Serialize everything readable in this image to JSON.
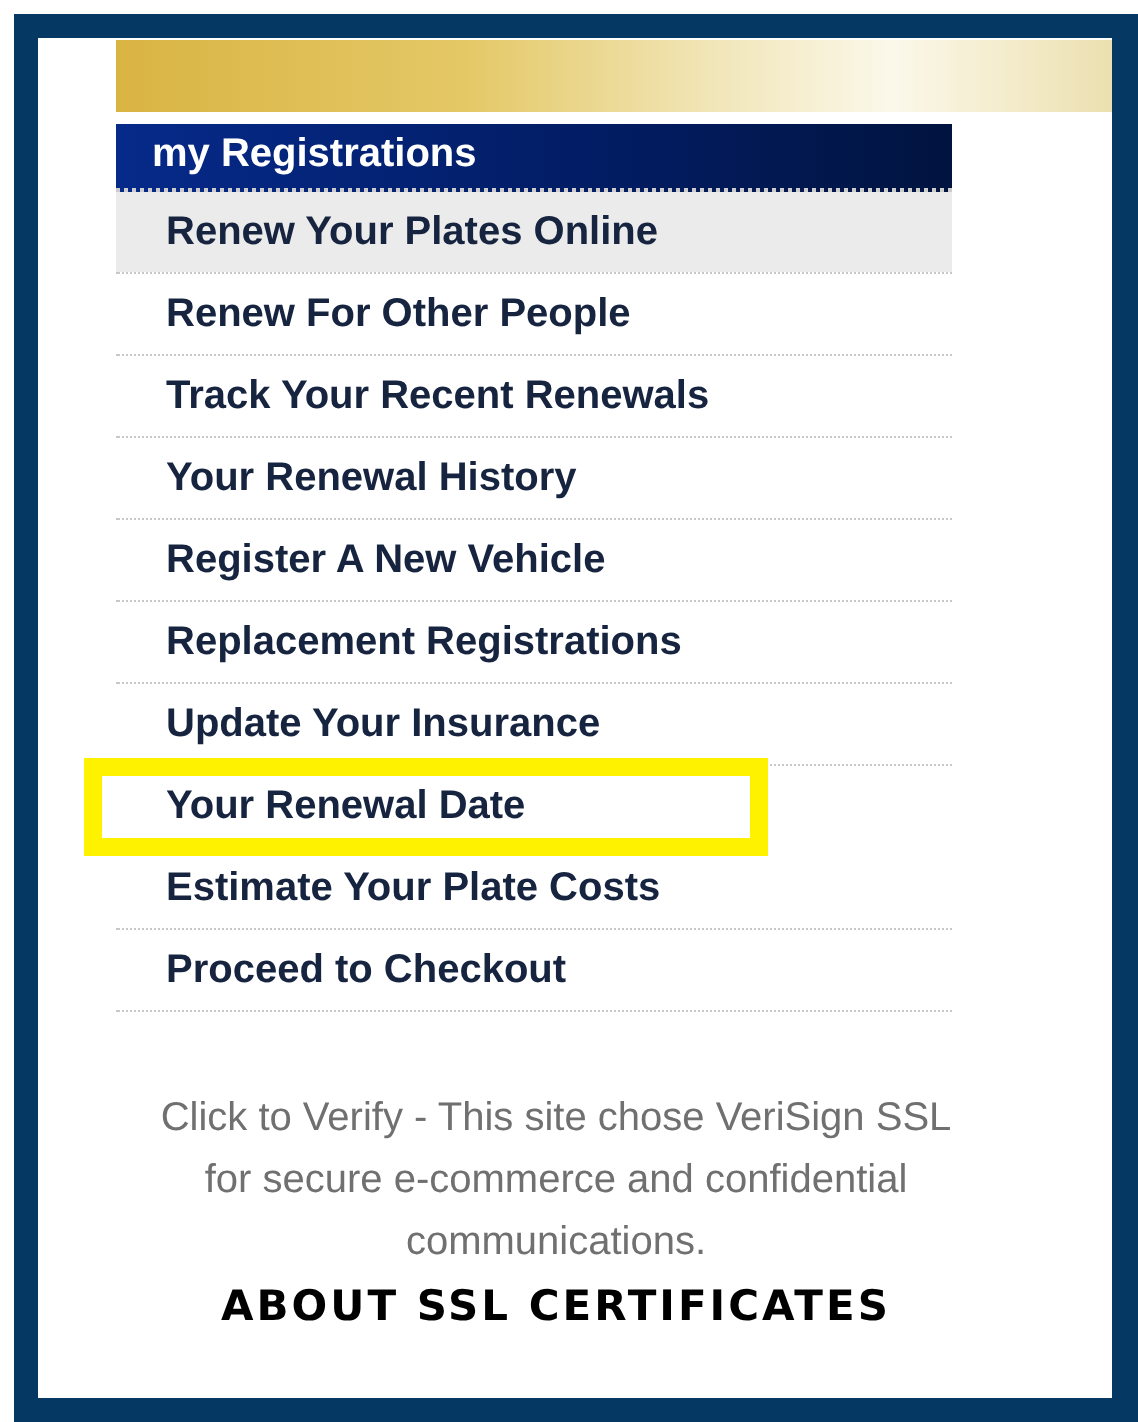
{
  "menu": {
    "title": "my Registrations",
    "items": [
      {
        "label": "Renew Your Plates Online",
        "selected": true,
        "highlighted": false
      },
      {
        "label": "Renew For Other People",
        "selected": false,
        "highlighted": false
      },
      {
        "label": "Track Your Recent Renewals",
        "selected": false,
        "highlighted": false
      },
      {
        "label": "Your Renewal History",
        "selected": false,
        "highlighted": false
      },
      {
        "label": "Register A New Vehicle",
        "selected": false,
        "highlighted": false
      },
      {
        "label": "Replacement Registrations",
        "selected": false,
        "highlighted": false
      },
      {
        "label": "Update Your Insurance",
        "selected": false,
        "highlighted": false
      },
      {
        "label": "Your Renewal Date",
        "selected": false,
        "highlighted": true
      },
      {
        "label": "Estimate Your Plate Costs",
        "selected": false,
        "highlighted": false
      },
      {
        "label": "Proceed to Checkout",
        "selected": false,
        "highlighted": false
      }
    ]
  },
  "ssl_notice": {
    "text": "Click to Verify - This site chose VeriSign SSL for secure e-commerce and confidential communications.",
    "link": "ABOUT SSL CERTIFICATES"
  }
}
